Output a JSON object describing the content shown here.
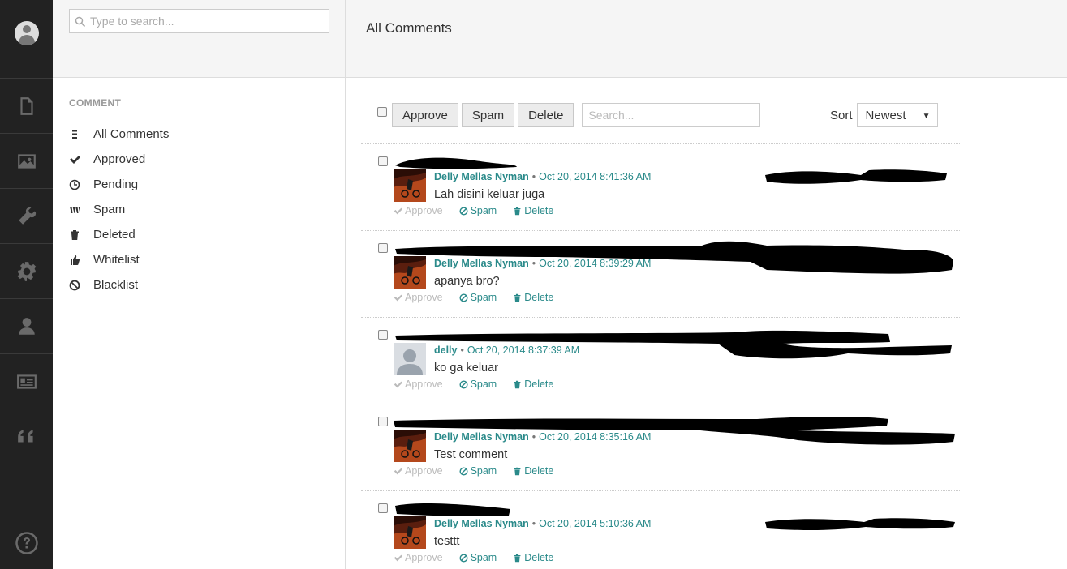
{
  "sidebar": {
    "icons": [
      "user-avatar",
      "page-icon",
      "image-icon",
      "wrench-icon",
      "gear-icon",
      "user-icon",
      "id-card-icon",
      "quote-icon",
      "help-icon"
    ]
  },
  "panel": {
    "search_placeholder": "Type to search...",
    "section_label": "COMMENT",
    "menu": [
      {
        "label": "All Comments",
        "icon": "list-icon"
      },
      {
        "label": "Approved",
        "icon": "check-icon"
      },
      {
        "label": "Pending",
        "icon": "clock-icon"
      },
      {
        "label": "Spam",
        "icon": "spam-icon"
      },
      {
        "label": "Deleted",
        "icon": "trash-icon"
      },
      {
        "label": "Whitelist",
        "icon": "thumbs-up-icon"
      },
      {
        "label": "Blacklist",
        "icon": "ban-icon"
      }
    ]
  },
  "main": {
    "title": "All Comments",
    "toolbar": {
      "approve": "Approve",
      "spam": "Spam",
      "delete": "Delete",
      "search_placeholder": "Search...",
      "sort_label": "Sort",
      "sort_value": "Newest"
    },
    "comments": [
      {
        "author": "Delly Mellas Nyman",
        "date": "Oct 20, 2014 8:41:36 AM",
        "text": "Lah disini keluar juga",
        "avatar": "photo"
      },
      {
        "author": "Delly Mellas Nyman",
        "date": "Oct 20, 2014 8:39:29 AM",
        "text": "apanya bro?",
        "avatar": "photo"
      },
      {
        "author": "delly",
        "date": "Oct 20, 2014 8:37:39 AM",
        "text": "ko ga keluar",
        "avatar": "default"
      },
      {
        "author": "Delly Mellas Nyman",
        "date": "Oct 20, 2014 8:35:16 AM",
        "text": "Test comment",
        "avatar": "photo"
      },
      {
        "author": "Delly Mellas Nyman",
        "date": "Oct 20, 2014 5:10:36 AM",
        "text": "testtt",
        "avatar": "photo"
      }
    ],
    "actions": {
      "approve": "Approve",
      "spam": "Spam",
      "delete": "Delete"
    },
    "colors": {
      "link": "#2a8a8a",
      "rail": "#222222",
      "muted": "#bbbbbb"
    }
  }
}
